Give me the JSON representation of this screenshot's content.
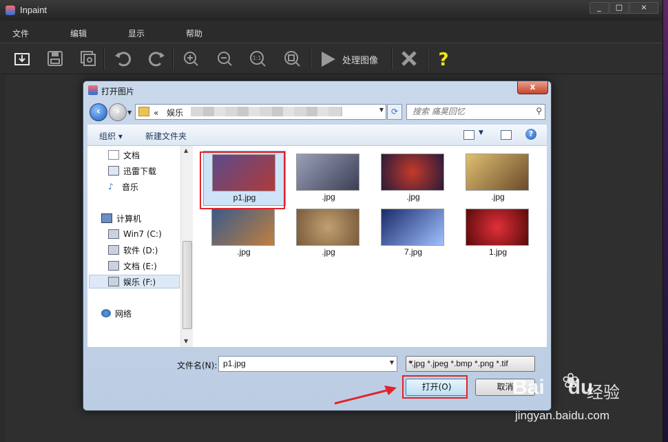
{
  "app": {
    "title": "Inpaint",
    "window_buttons": [
      "_",
      "□",
      "×"
    ],
    "menu": [
      "文件",
      "编辑",
      "显示",
      "帮助"
    ],
    "toolbar": {
      "icons": [
        "open-icon",
        "save-icon",
        "preview-icon",
        "undo-icon",
        "redo-icon",
        "zoom-in-icon",
        "zoom-out-icon",
        "actual-size-icon",
        "fit-window-icon",
        "process-icon",
        "remove-icon",
        "help-icon"
      ],
      "process_label": "处理图像"
    }
  },
  "dialog": {
    "title": "打开图片",
    "close": "x",
    "address": {
      "prefix": "«",
      "crumb": "娱乐"
    },
    "search_placeholder": "搜索 痛昊回忆",
    "commands": {
      "organize": "组织 ▾",
      "new_folder": "新建文件夹"
    },
    "nav": [
      {
        "label": "文档",
        "icon": "document-icon"
      },
      {
        "label": "迅雷下载",
        "icon": "download-folder-icon"
      },
      {
        "label": "音乐",
        "icon": "music-icon"
      },
      {
        "label": "计算机",
        "icon": "computer-icon"
      },
      {
        "label": "Win7 (C:)",
        "icon": "drive-icon"
      },
      {
        "label": "软件 (D:)",
        "icon": "drive-icon"
      },
      {
        "label": "文档 (E:)",
        "icon": "drive-icon"
      },
      {
        "label": "娱乐 (F:)",
        "icon": "drive-icon",
        "selected": true
      },
      {
        "label": "网络",
        "icon": "network-icon"
      }
    ],
    "files": [
      {
        "name": "p1.jpg",
        "selected": true,
        "colors": [
          "#5b4a8a",
          "#b03a3a"
        ]
      },
      {
        "name": ".jpg",
        "colors": [
          "#9aa0b8",
          "#3b3f55"
        ]
      },
      {
        "name": ".jpg",
        "colors": [
          "#2a1a3a",
          "#c43a2a"
        ]
      },
      {
        "name": ".jpg",
        "colors": [
          "#e0c070",
          "#6a4a2a"
        ]
      },
      {
        "name": ".jpg",
        "colors": [
          "#3a5a8a",
          "#c08040"
        ]
      },
      {
        "name": ".jpg",
        "colors": [
          "#7a5a3a",
          "#c0a070"
        ]
      },
      {
        "name": "7.jpg",
        "colors": [
          "#1a2a6a",
          "#a0c0ff"
        ]
      },
      {
        "name": "1.jpg",
        "colors": [
          "#5a0a0a",
          "#e0303a"
        ]
      }
    ],
    "filename_label": "文件名(N):",
    "filename_value": "p1.jpg",
    "filetype": "*.jpg *.jpeg *.bmp *.png *.tif",
    "open_button": "打开(O)",
    "cancel_button": "取消"
  },
  "watermark": {
    "brand": "Bai",
    "brand2": "du",
    "jingyan": "经验",
    "url": "jingyan.baidu.com"
  },
  "colors": {
    "annotation_red": "#e0242c",
    "titlebar": "#2b2b2b",
    "dialog_frame": "#c9d8ea"
  }
}
